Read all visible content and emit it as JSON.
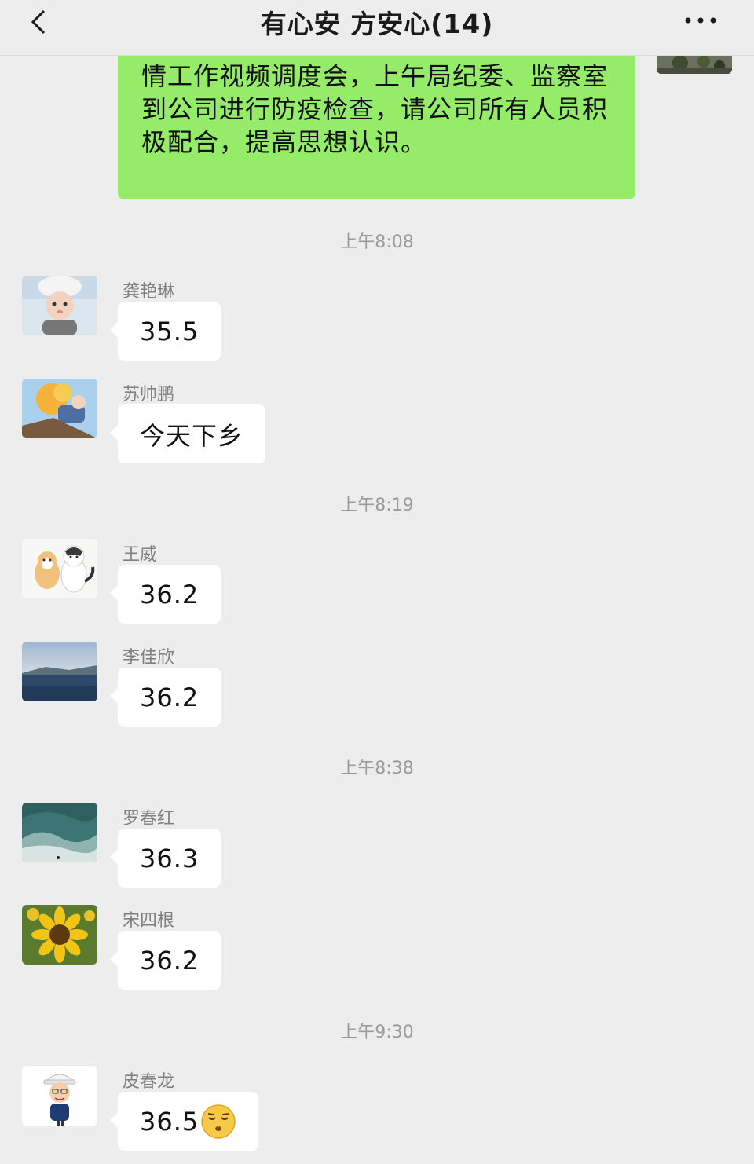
{
  "header": {
    "title": "有心安 方安心(14)",
    "back_icon": "chevron-left-icon",
    "more_icon": "more-dots-icon"
  },
  "top_message": {
    "text": "情工作视频调度会，上午局纪委、监察室到公司进行防疫检查，请公司所有人员积极配合，提高思想认识。",
    "bubble_color": "#95ec69"
  },
  "timestamps": [
    "上午8:08",
    "上午8:19",
    "上午8:38",
    "上午9:30"
  ],
  "messages": [
    {
      "sender": "龚艳琳",
      "text": "35.5",
      "avatar": "child-photo-avatar"
    },
    {
      "sender": "苏帅鹏",
      "text": "今天下乡",
      "avatar": "anime-avatar"
    },
    {
      "sender": "王威",
      "text": "36.2",
      "avatar": "cartoon-cats-avatar"
    },
    {
      "sender": "李佳欣",
      "text": "36.2",
      "avatar": "lake-landscape-avatar"
    },
    {
      "sender": "罗春红",
      "text": "36.3",
      "avatar": "ocean-wave-avatar"
    },
    {
      "sender": "宋四根",
      "text": "36.2",
      "avatar": "sunflower-avatar"
    },
    {
      "sender": "皮春龙",
      "text": "36.5",
      "avatar": "cartoon-worker-avatar",
      "emoji": "relieved-face-icon"
    }
  ],
  "colors": {
    "background": "#ededed",
    "self_bubble": "#95ec69",
    "other_bubble": "#ffffff",
    "timestamp_text": "#9b9b9b",
    "sender_text": "#808080"
  }
}
